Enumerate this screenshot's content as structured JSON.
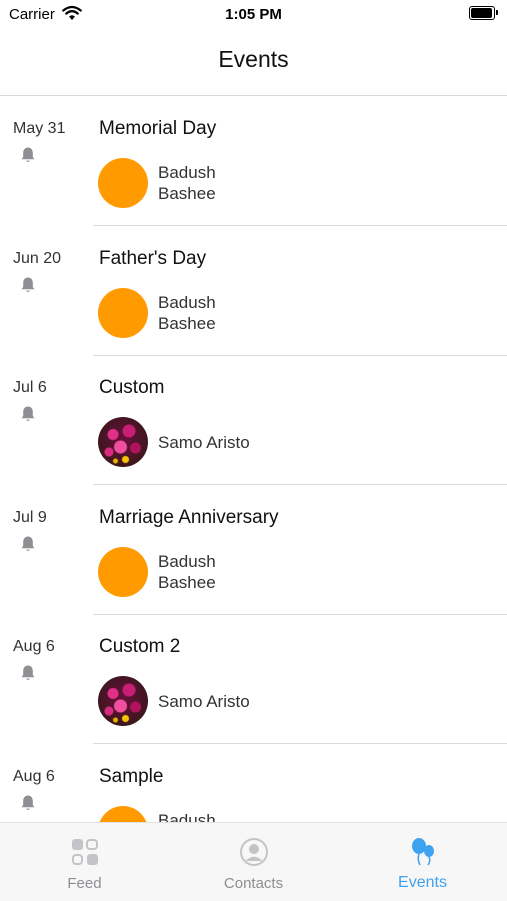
{
  "status_bar": {
    "carrier": "Carrier",
    "time": "1:05 PM"
  },
  "nav": {
    "title": "Events"
  },
  "events": [
    {
      "date": "May 31",
      "title": "Memorial Day",
      "person": {
        "name": "Badush Bashee",
        "avatar": "orange-circle"
      }
    },
    {
      "date": "Jun 20",
      "title": "Father's Day",
      "person": {
        "name": "Badush Bashee",
        "avatar": "orange-circle"
      }
    },
    {
      "date": "Jul 6",
      "title": "Custom",
      "person": {
        "name": "Samo Aristo",
        "avatar": "flower-photo"
      }
    },
    {
      "date": "Jul 9",
      "title": "Marriage Anniversary",
      "person": {
        "name": "Badush Bashee",
        "avatar": "orange-circle"
      }
    },
    {
      "date": "Aug 6",
      "title": "Custom 2",
      "person": {
        "name": "Samo Aristo",
        "avatar": "flower-photo"
      }
    },
    {
      "date": "Aug 6",
      "title": "Sample",
      "person": {
        "name": "Badush Bashee",
        "avatar": "orange-circle"
      }
    }
  ],
  "tab_bar": {
    "tabs": [
      {
        "label": "Feed",
        "icon": "grid-icon",
        "active": false
      },
      {
        "label": "Contacts",
        "icon": "person-icon",
        "active": false
      },
      {
        "label": "Events",
        "icon": "balloons-icon",
        "active": true
      }
    ]
  },
  "colors": {
    "accent": "#3da3f0",
    "avatar_orange": "#ff9a00",
    "tab_inactive": "#8e8e93"
  }
}
